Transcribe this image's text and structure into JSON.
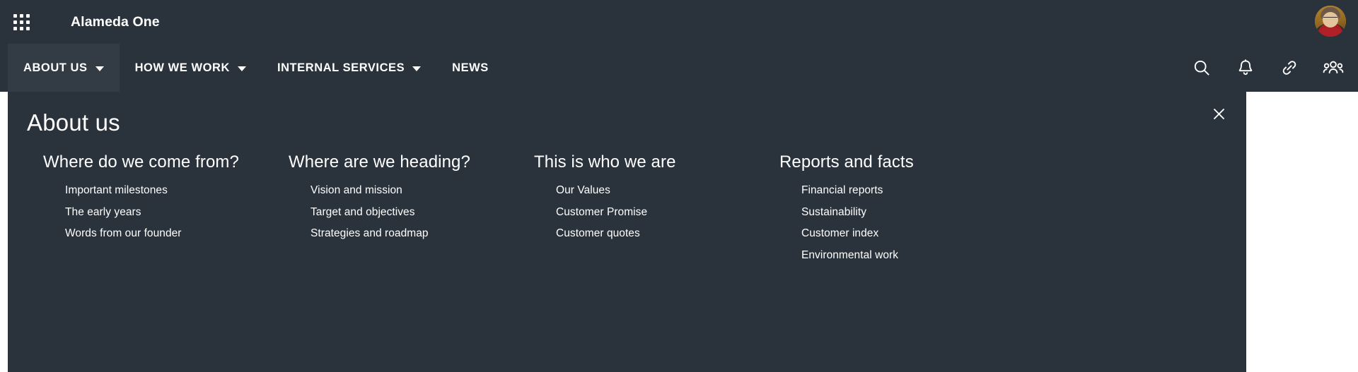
{
  "topbar": {
    "app_launcher_icon": "grid-apps-icon",
    "brand": "Alameda One",
    "avatar_icon": "user-avatar"
  },
  "nav": {
    "items": [
      {
        "label": "ABOUT US",
        "has_caret": true,
        "active": true
      },
      {
        "label": "HOW WE WORK",
        "has_caret": true,
        "active": false
      },
      {
        "label": "INTERNAL SERVICES",
        "has_caret": true,
        "active": false
      },
      {
        "label": "NEWS",
        "has_caret": false,
        "active": false
      }
    ],
    "icons": [
      {
        "name": "search-icon"
      },
      {
        "name": "bell-icon"
      },
      {
        "name": "link-icon"
      },
      {
        "name": "people-icon"
      }
    ]
  },
  "megamenu": {
    "title": "About us",
    "close_icon": "close-icon",
    "columns": [
      {
        "title": "Where do we come from?",
        "links": [
          "Important milestones",
          "The early years",
          "Words from our founder"
        ]
      },
      {
        "title": "Where are we heading?",
        "links": [
          "Vision and mission",
          "Target and objectives",
          "Strategies and roadmap"
        ]
      },
      {
        "title": "This is who we are",
        "links": [
          "Our Values",
          "Customer Promise",
          "Customer quotes"
        ]
      },
      {
        "title": "Reports and facts",
        "links": [
          "Financial reports",
          "Sustainability",
          "Customer index",
          "Environmental work"
        ]
      }
    ]
  },
  "colors": {
    "header_bg": "#2a323b",
    "active_tab_bg": "#333b45",
    "text": "#ffffff",
    "page_bg": "#ffffff"
  }
}
